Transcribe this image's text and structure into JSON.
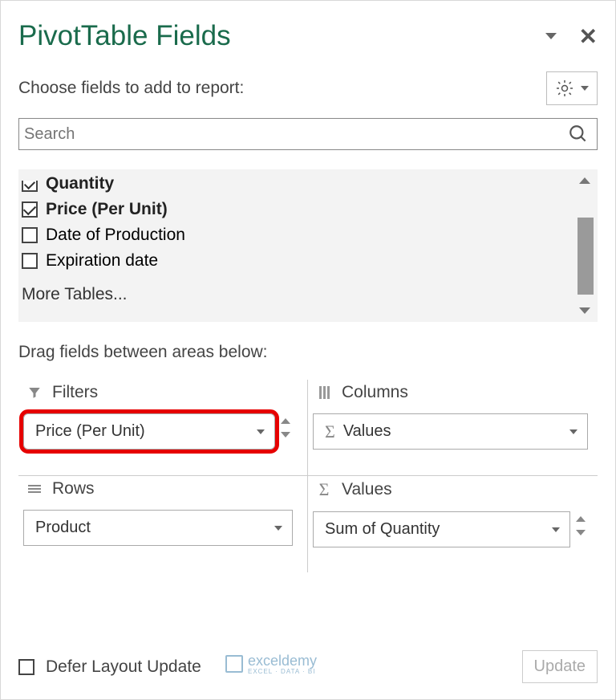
{
  "header": {
    "title": "PivotTable Fields"
  },
  "subheader": {
    "choose_label": "Choose fields to add to report:"
  },
  "search": {
    "placeholder": "Search"
  },
  "fields": [
    {
      "label": "Quantity",
      "checked": true,
      "bold": true,
      "partial": true
    },
    {
      "label": "Price (Per Unit)",
      "checked": true,
      "bold": true,
      "partial": false
    },
    {
      "label": "Date of Production",
      "checked": false,
      "bold": false,
      "partial": false
    },
    {
      "label": "Expiration date",
      "checked": false,
      "bold": false,
      "partial": false
    }
  ],
  "more_tables": "More Tables...",
  "drag_hint": "Drag fields between areas below:",
  "areas": {
    "filters": {
      "label": "Filters",
      "item": "Price (Per Unit)"
    },
    "columns": {
      "label": "Columns",
      "item": "Values"
    },
    "rows": {
      "label": "Rows",
      "item": "Product"
    },
    "values": {
      "label": "Values",
      "item": "Sum of Quantity"
    }
  },
  "footer": {
    "defer_label": "Defer Layout Update",
    "update_label": "Update"
  },
  "watermark": {
    "brand": "exceldemy",
    "tag": "EXCEL · DATA · BI"
  }
}
